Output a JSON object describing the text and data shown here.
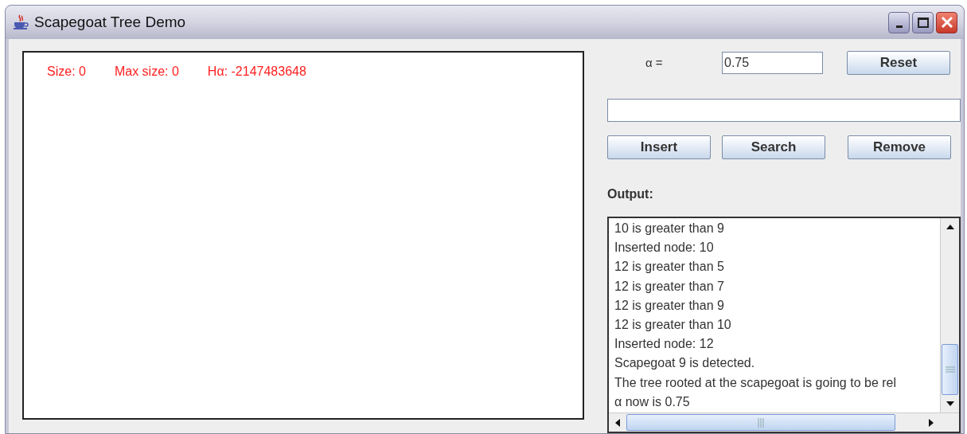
{
  "window": {
    "title": "Scapegoat Tree Demo"
  },
  "canvas": {
    "stats": [
      "Size: 0",
      "Max size: 0",
      "Hα: -2147483648"
    ]
  },
  "alpha": {
    "label": "α =",
    "value": "0.75"
  },
  "reset_button": "Reset",
  "buttons": [
    "Insert",
    "Search",
    "Remove"
  ],
  "output": {
    "label": "Output:",
    "lines": [
      "10 is greater than 9",
      "Inserted node: 10",
      "12 is greater than 5",
      "12 is greater than 7",
      "12 is greater than 9",
      "12 is greater than 10",
      "Inserted node: 12",
      "Scapegoat 9 is detected.",
      "The tree rooted at the scapegoat is going to be rel",
      "α now is 0.75"
    ]
  }
}
